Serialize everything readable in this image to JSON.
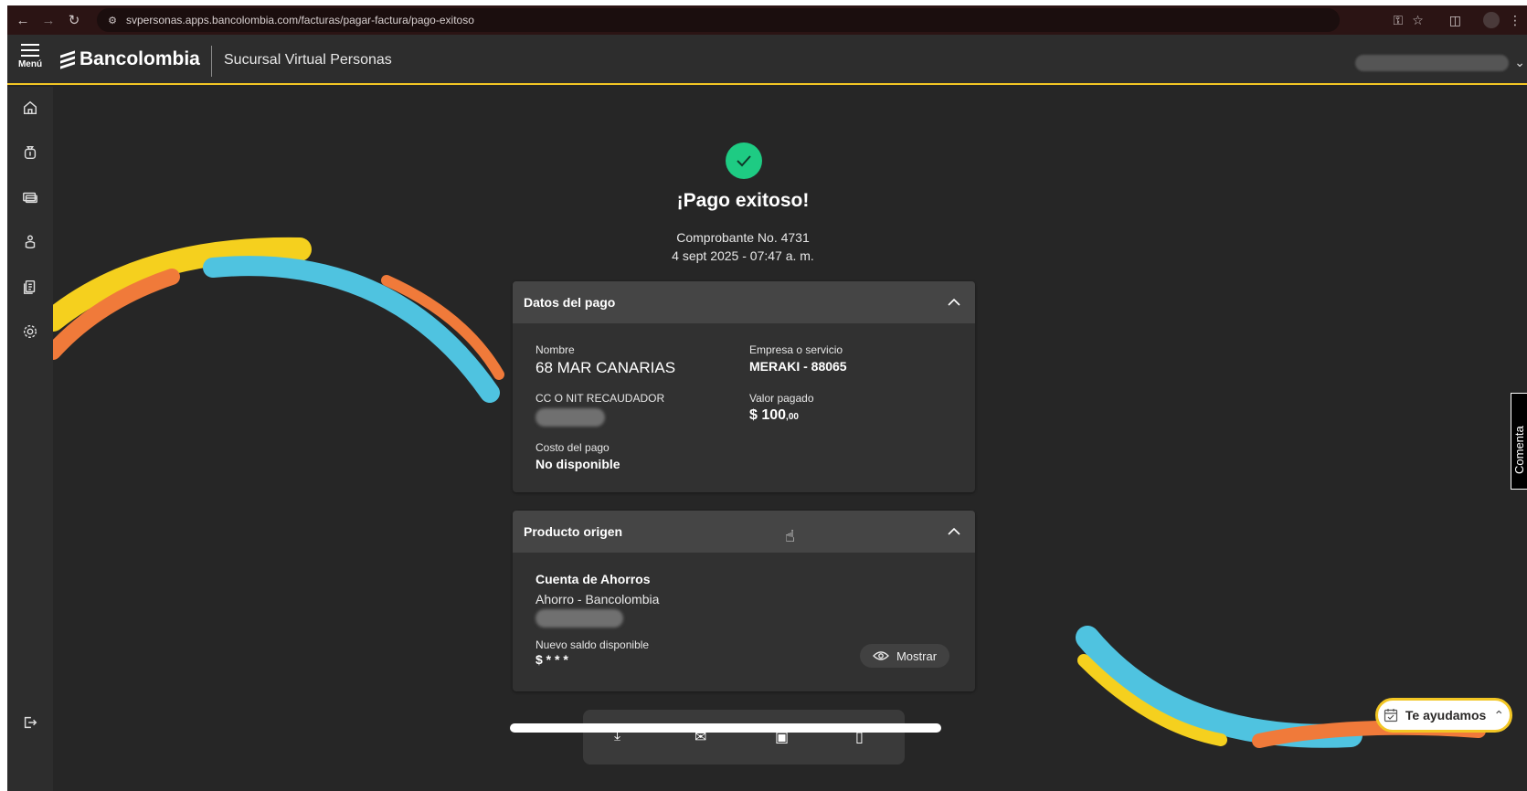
{
  "browser": {
    "url": "svpersonas.apps.bancolombia.com/facturas/pagar-factura/pago-exitoso"
  },
  "header": {
    "menu_label": "Menú",
    "brand": "Bancolombia",
    "site_title": "Sucursal Virtual Personas"
  },
  "result": {
    "title": "¡Pago exitoso!",
    "receipt": "Comprobante No. 4731",
    "datetime": "4 sept 2025 - 07:47 a. m."
  },
  "payment_card": {
    "heading": "Datos del pago",
    "name_label": "Nombre",
    "name_value": "68 MAR CANARIAS",
    "company_label": "Empresa o servicio",
    "company_value": "MERAKI - 88065",
    "nit_label": "CC O NIT RECAUDADOR",
    "amount_label": "Valor pagado",
    "amount_main": "$ 100",
    "amount_cents": ",00",
    "cost_label": "Costo del pago",
    "cost_value": "No disponible"
  },
  "origin_card": {
    "heading": "Producto origen",
    "account_type": "Cuenta de Ahorros",
    "account_name": "Ahorro - Bancolombia",
    "balance_label": "Nuevo saldo disponible",
    "balance_value": "$ * * *",
    "show_button": "Mostrar"
  },
  "help_button": "Te ayudamos",
  "feedback_tab": "Comenta",
  "colors": {
    "accent_yellow": "#f2c624",
    "success_green": "#1ecb83",
    "arc_blue": "#4fc3e0",
    "arc_orange": "#f07a3a",
    "arc_yellow": "#f5d01e"
  }
}
